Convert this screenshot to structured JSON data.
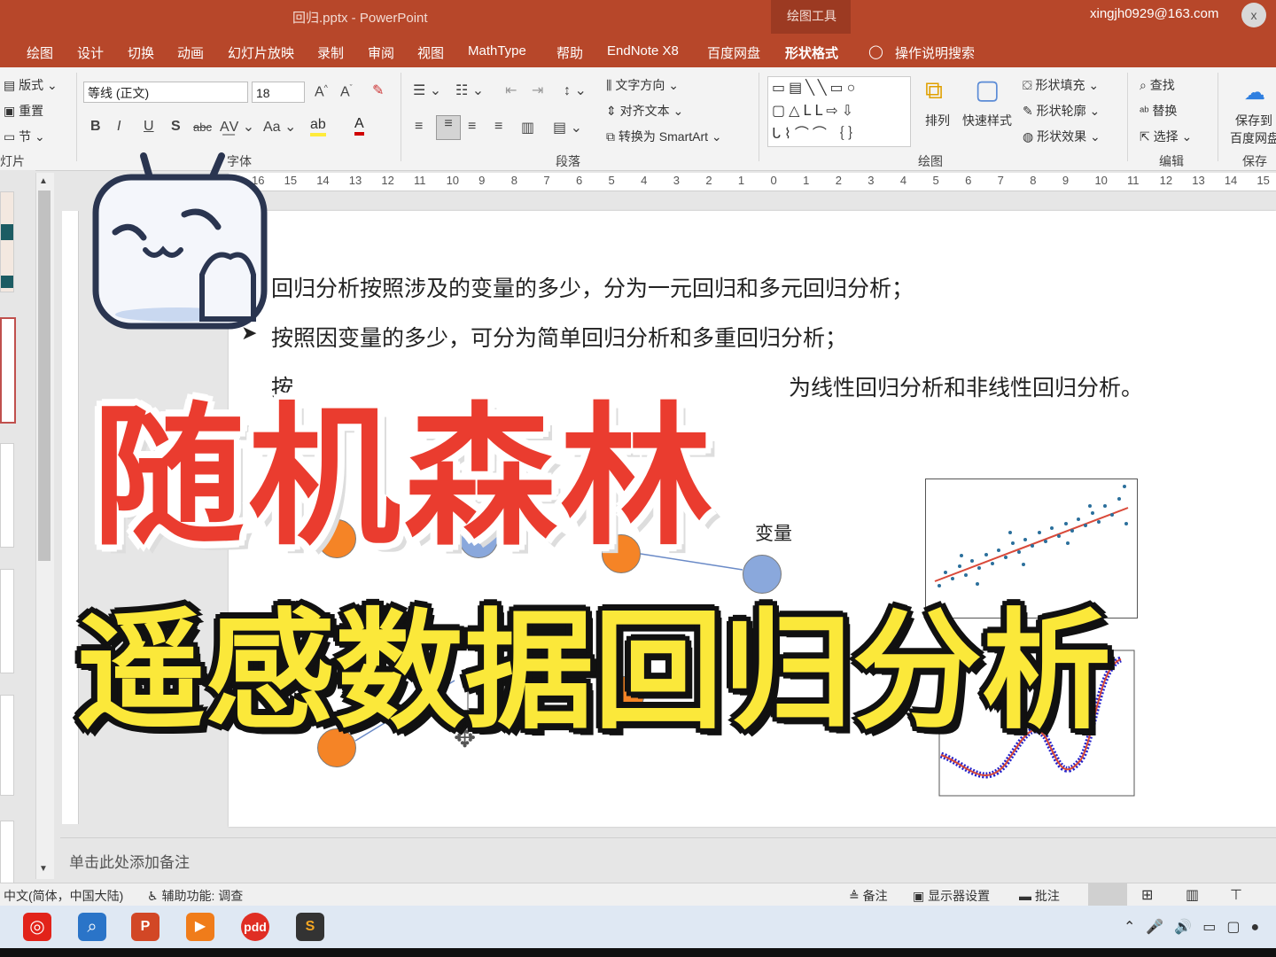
{
  "window": {
    "title": "回归.pptx  -  PowerPoint",
    "context_tools": "绘图工具",
    "user": "xingjh0929@163.com",
    "close_glyph": "x"
  },
  "tabs": [
    {
      "label": "绘图"
    },
    {
      "label": "设计"
    },
    {
      "label": "切换"
    },
    {
      "label": "动画"
    },
    {
      "label": "幻灯片放映"
    },
    {
      "label": "录制"
    },
    {
      "label": "审阅"
    },
    {
      "label": "视图"
    },
    {
      "label": "MathType"
    },
    {
      "label": "帮助"
    },
    {
      "label": "EndNote X8"
    },
    {
      "label": "百度网盘"
    },
    {
      "label": "形状格式"
    },
    {
      "label": "操作说明搜索"
    }
  ],
  "ribbon": {
    "slides_group": {
      "layout": "版式",
      "reset": "重置",
      "section": "节",
      "label": "灯片"
    },
    "font_group": {
      "font_name": "等线 (正文)",
      "font_size": "18",
      "label": "字体"
    },
    "paragraph_group": {
      "text_direction": "文字方向",
      "align_text": "对齐文本",
      "convert_smartart": "转换为 SmartArt",
      "label": "段落"
    },
    "drawing_group": {
      "arrange": "排列",
      "quick_styles": "快速样式",
      "shape_fill": "形状填充",
      "shape_outline": "形状轮廓",
      "shape_effects": "形状效果",
      "label": "绘图"
    },
    "editing_group": {
      "find": "查找",
      "replace": "替换",
      "select": "选择",
      "label": "编辑"
    },
    "save_group": {
      "save_to": "保存到",
      "baidu": "百度网盘",
      "label": "保存"
    }
  },
  "ruler": {
    "ticks": [
      "16",
      "15",
      "14",
      "13",
      "12",
      "11",
      "10",
      "9",
      "8",
      "7",
      "6",
      "5",
      "4",
      "3",
      "2",
      "1",
      "0",
      "1",
      "2",
      "3",
      "4",
      "5",
      "6",
      "7",
      "8",
      "9",
      "10",
      "11",
      "12",
      "13",
      "14",
      "15"
    ]
  },
  "slide": {
    "line1": "回归分析按照涉及的变量的多少，分为一元回归和多元回归分析；",
    "line2_bullet": "➤",
    "line2": "按照因变量的多少，可分为简单回归分析和多重回归分析；",
    "line3_prefix": "按",
    "line3_suffix": "为线性回归分析和非线性回归分析。",
    "var_label": "变量"
  },
  "overlay": {
    "title_red": "随机森林",
    "title_yellow": "遥感数据回归分析"
  },
  "notes": {
    "placeholder": "单击此处添加备注"
  },
  "status": {
    "language": "中文(简体，中国大陆)",
    "accessibility": "辅助功能: 调查",
    "notes_btn": "备注",
    "display_settings": "显示器设置",
    "comments": "批注"
  },
  "colors": {
    "ppt_brand": "#b7472a",
    "overlay_red": "#ea3c2f",
    "overlay_yellow": "#fbe83a",
    "node_orange": "#f58426",
    "node_blue": "#8aa8dc"
  }
}
